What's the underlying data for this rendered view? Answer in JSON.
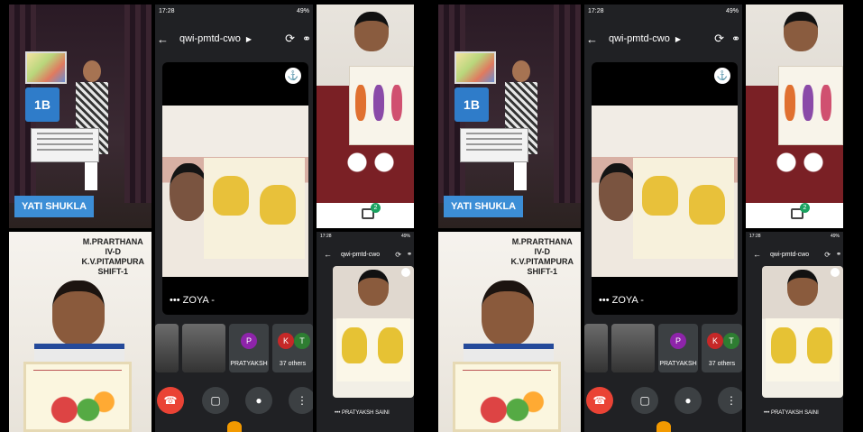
{
  "frames": [
    {
      "id": "left"
    },
    {
      "id": "right"
    }
  ],
  "student_top": {
    "class_badge": "1B",
    "name_chip": "YATI SHUKLA"
  },
  "student_bottom": {
    "caption": [
      "M.PRARTHANA",
      "IV-D",
      "K.V.PITAMPURA",
      "SHIFT-1"
    ]
  },
  "meet": {
    "status_time": "17:28",
    "status_right": "49%",
    "back_icon": "arrow-left-icon",
    "meeting_code": "qwi-pmtd-cwo",
    "main_tile_name": "••• ZOYA -",
    "participants": [
      {
        "initial": "P",
        "name": "PRATYAKSH",
        "color": "#8e24aa"
      },
      {
        "initial": "K",
        "name": "",
        "color": "#c62828"
      },
      {
        "initial": "T",
        "name": "",
        "color": "#2e7d32"
      }
    ],
    "others_label": "37 others",
    "chat_count": "2"
  },
  "mini_meet": {
    "meeting_code": "qwi-pmtd-cwo",
    "tile_name": "••• PRATYAKSH SAINI"
  }
}
